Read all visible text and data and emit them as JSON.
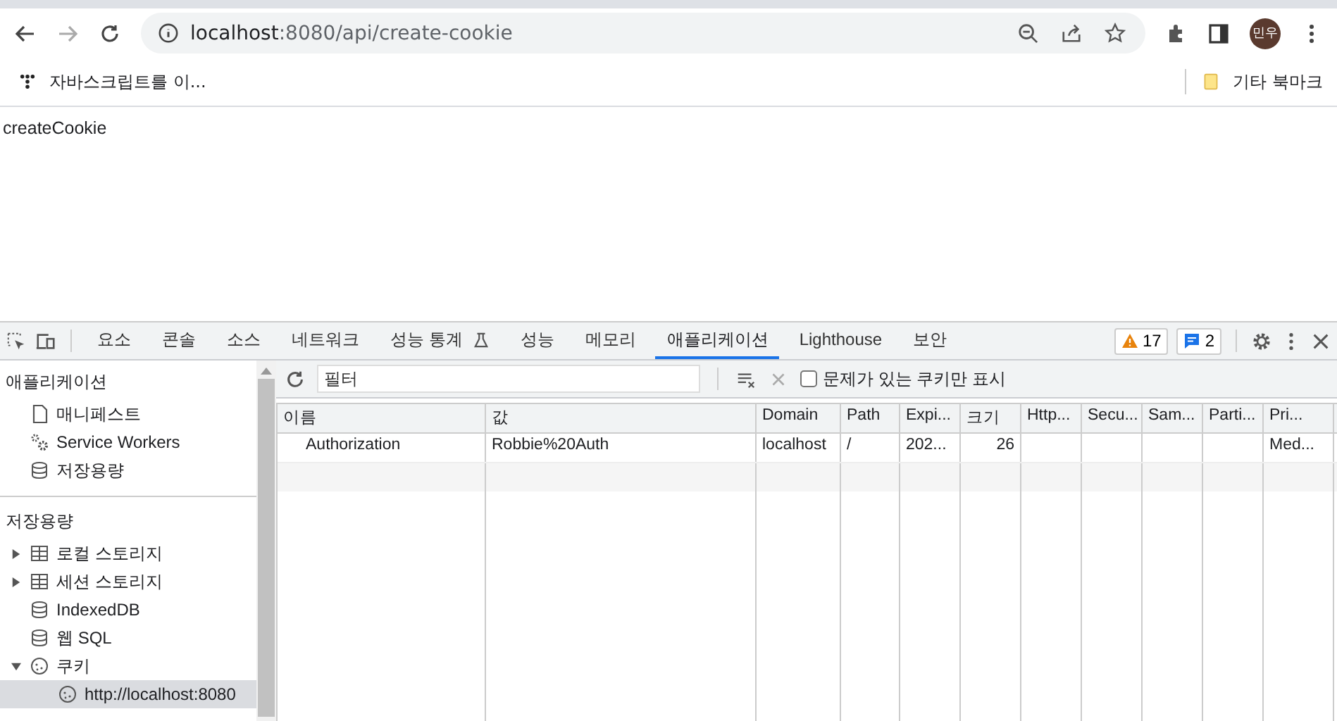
{
  "browser": {
    "address": {
      "host": "localhost",
      "path": ":8080/api/create-cookie"
    },
    "profile": "민우",
    "bookmarks": [
      {
        "label": "자바스크립트를 이..."
      }
    ],
    "other_bookmarks": "기타 북마크"
  },
  "page": {
    "text": "createCookie"
  },
  "devtools": {
    "tabs": [
      {
        "label": "요소",
        "selected": false
      },
      {
        "label": "콘솔",
        "selected": false
      },
      {
        "label": "소스",
        "selected": false
      },
      {
        "label": "네트워크",
        "selected": false
      },
      {
        "label": "성능 통계",
        "selected": false,
        "kind": "flask"
      },
      {
        "label": "성능",
        "selected": false
      },
      {
        "label": "메모리",
        "selected": false
      },
      {
        "label": "애플리케이션",
        "selected": true
      },
      {
        "label": "Lighthouse",
        "selected": false
      },
      {
        "label": "보안",
        "selected": false
      }
    ],
    "warnings": "17",
    "messages": "2",
    "filter": {
      "placeholder": "필터"
    },
    "issues_only": {
      "label": "문제가 있는 쿠키만 표시",
      "checked": false
    },
    "sidebar": [
      {
        "title": "애플리케이션",
        "items": [
          {
            "label": "매니페스트",
            "kind": "file"
          },
          {
            "label": "Service Workers",
            "kind": "gears"
          },
          {
            "label": "저장용량",
            "kind": "db"
          }
        ]
      },
      {
        "title": "저장용량",
        "items": [
          {
            "label": "로컬 스토리지",
            "kind": "table",
            "expanded": false
          },
          {
            "label": "세션 스토리지",
            "kind": "table",
            "expanded": false
          },
          {
            "label": "IndexedDB",
            "kind": "db"
          },
          {
            "label": "웹 SQL",
            "kind": "db"
          },
          {
            "label": "쿠키",
            "kind": "cookie",
            "expanded": true,
            "children": [
              {
                "label": "http://localhost:8080",
                "kind": "cookie",
                "selected": true
              }
            ]
          }
        ]
      }
    ],
    "table": {
      "columns": [
        "이름",
        "값",
        "Domain",
        "Path",
        "Expi...",
        "크기",
        "Http...",
        "Secu...",
        "Sam...",
        "Parti...",
        "Pri..."
      ],
      "rows": [
        {
          "selected": false,
          "cells": [
            "Authorization",
            "Robbie%20Auth",
            "localhost",
            "/",
            "202...",
            "26",
            "",
            "",
            "",
            "",
            "Med..."
          ]
        }
      ]
    }
  }
}
